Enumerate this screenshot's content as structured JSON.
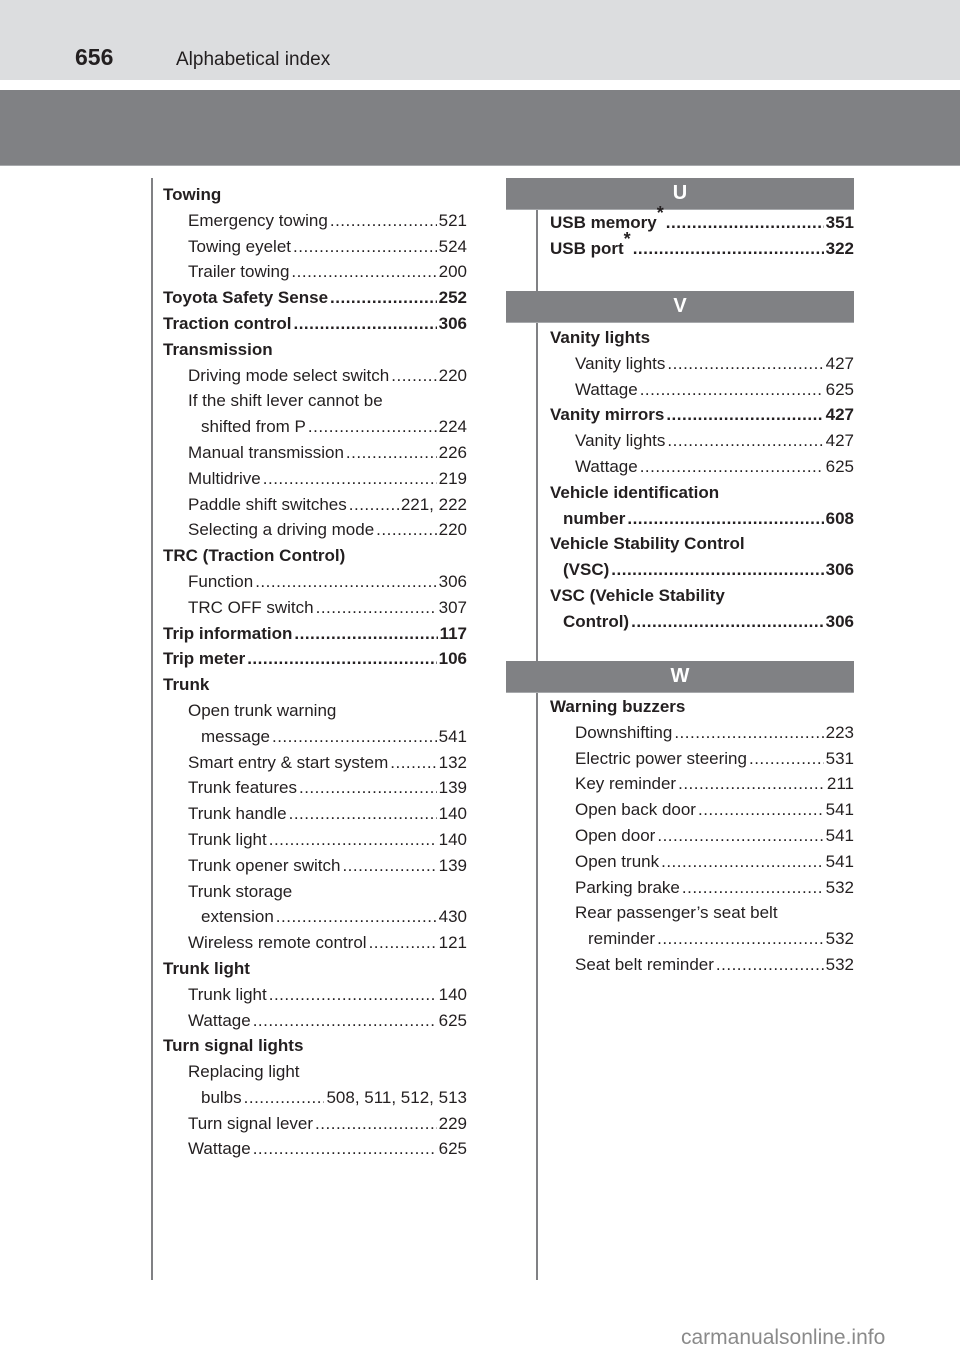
{
  "header": {
    "page_number": "656",
    "title": "Alphabetical index"
  },
  "left_column": [
    {
      "label": "Towing",
      "page": "",
      "level": 0,
      "bold": true
    },
    {
      "label": "Emergency towing",
      "page": "521",
      "level": 1,
      "bold": false
    },
    {
      "label": "Towing eyelet",
      "page": "524",
      "level": 1,
      "bold": false
    },
    {
      "label": "Trailer towing",
      "page": "200",
      "level": 1,
      "bold": false
    },
    {
      "label": "Toyota Safety Sense",
      "page": "252",
      "level": 0,
      "bold": true
    },
    {
      "label": "Traction control",
      "page": "306",
      "level": 0,
      "bold": true
    },
    {
      "label": "Transmission",
      "page": "",
      "level": 0,
      "bold": true
    },
    {
      "label": "Driving mode select switch",
      "page": "220",
      "level": 1,
      "bold": false
    },
    {
      "label": "If the shift lever cannot be",
      "page": "",
      "level": 1,
      "bold": false
    },
    {
      "label": "shifted from P",
      "page": "224",
      "level": 2,
      "bold": false
    },
    {
      "label": "Manual transmission",
      "page": "226",
      "level": 1,
      "bold": false
    },
    {
      "label": "Multidrive",
      "page": "219",
      "level": 1,
      "bold": false
    },
    {
      "label": "Paddle shift switches",
      "page": "221, 222",
      "level": 1,
      "bold": false
    },
    {
      "label": "Selecting a driving mode",
      "page": "220",
      "level": 1,
      "bold": false
    },
    {
      "label": "TRC (Traction Control)",
      "page": "",
      "level": 0,
      "bold": true
    },
    {
      "label": "Function",
      "page": "306",
      "level": 1,
      "bold": false
    },
    {
      "label": "TRC OFF switch",
      "page": "307",
      "level": 1,
      "bold": false
    },
    {
      "label": "Trip information",
      "page": "117",
      "level": 0,
      "bold": true
    },
    {
      "label": "Trip meter",
      "page": "106",
      "level": 0,
      "bold": true
    },
    {
      "label": "Trunk",
      "page": "",
      "level": 0,
      "bold": true
    },
    {
      "label": "Open trunk warning",
      "page": "",
      "level": 1,
      "bold": false
    },
    {
      "label": "message",
      "page": "541",
      "level": 2,
      "bold": false
    },
    {
      "label": "Smart entry & start system",
      "page": "132",
      "level": 1,
      "bold": false
    },
    {
      "label": "Trunk features",
      "page": "139",
      "level": 1,
      "bold": false
    },
    {
      "label": "Trunk handle",
      "page": "140",
      "level": 1,
      "bold": false
    },
    {
      "label": "Trunk light",
      "page": "140",
      "level": 1,
      "bold": false
    },
    {
      "label": "Trunk opener switch",
      "page": "139",
      "level": 1,
      "bold": false
    },
    {
      "label": "Trunk storage",
      "page": "",
      "level": 1,
      "bold": false
    },
    {
      "label": "extension",
      "page": "430",
      "level": 2,
      "bold": false
    },
    {
      "label": "Wireless remote control",
      "page": "121",
      "level": 1,
      "bold": false
    },
    {
      "label": "Trunk light",
      "page": "",
      "level": 0,
      "bold": true
    },
    {
      "label": "Trunk light",
      "page": "140",
      "level": 1,
      "bold": false
    },
    {
      "label": "Wattage",
      "page": "625",
      "level": 1,
      "bold": false
    },
    {
      "label": "Turn signal lights",
      "page": "",
      "level": 0,
      "bold": true
    },
    {
      "label": "Replacing light",
      "page": "",
      "level": 1,
      "bold": false
    },
    {
      "label": "bulbs",
      "page": "508, 511, 512, 513",
      "level": 2,
      "bold": false
    },
    {
      "label": "Turn signal lever",
      "page": "229",
      "level": 1,
      "bold": false
    },
    {
      "label": "Wattage",
      "page": "625",
      "level": 1,
      "bold": false
    }
  ],
  "right_sections": [
    {
      "letter": "U",
      "entries": [
        {
          "label": "USB memory",
          "asterisk": "*",
          "page": "351",
          "level": 0,
          "bold": true
        },
        {
          "label": "USB port",
          "asterisk": "*",
          "page": "322",
          "level": 0,
          "bold": true
        }
      ]
    },
    {
      "letter": "V",
      "entries": [
        {
          "label": "Vanity lights",
          "page": "",
          "level": 0,
          "bold": true
        },
        {
          "label": "Vanity lights",
          "page": "427",
          "level": 1,
          "bold": false
        },
        {
          "label": "Wattage",
          "page": "625",
          "level": 1,
          "bold": false
        },
        {
          "label": "Vanity mirrors",
          "page": "427",
          "level": 0,
          "bold": true
        },
        {
          "label": "Vanity lights",
          "page": "427",
          "level": 1,
          "bold": false
        },
        {
          "label": "Wattage",
          "page": "625",
          "level": 1,
          "bold": false
        },
        {
          "label": "Vehicle identification",
          "page": "",
          "level": 0,
          "bold": true
        },
        {
          "label": "number",
          "page": "608",
          "level": 2,
          "bold": true
        },
        {
          "label": "Vehicle Stability Control",
          "page": "",
          "level": 0,
          "bold": true
        },
        {
          "label": "(VSC)",
          "page": "306",
          "level": 2,
          "bold": true
        },
        {
          "label": "VSC (Vehicle Stability",
          "page": "",
          "level": 0,
          "bold": true
        },
        {
          "label": "Control)",
          "page": "306",
          "level": 2,
          "bold": true
        }
      ]
    },
    {
      "letter": "W",
      "entries": [
        {
          "label": "Warning buzzers",
          "page": "",
          "level": 0,
          "bold": true
        },
        {
          "label": "Downshifting",
          "page": "223",
          "level": 1,
          "bold": false
        },
        {
          "label": "Electric power steering",
          "page": "531",
          "level": 1,
          "bold": false
        },
        {
          "label": "Key reminder",
          "page": "211",
          "level": 1,
          "bold": false
        },
        {
          "label": "Open back door",
          "page": "541",
          "level": 1,
          "bold": false
        },
        {
          "label": "Open door",
          "page": "541",
          "level": 1,
          "bold": false
        },
        {
          "label": "Open trunk",
          "page": "541",
          "level": 1,
          "bold": false
        },
        {
          "label": "Parking brake",
          "page": "532",
          "level": 1,
          "bold": false
        },
        {
          "label": "Rear passenger’s seat belt",
          "page": "",
          "level": 1,
          "bold": false
        },
        {
          "label": "reminder",
          "page": "532",
          "level": 2,
          "bold": false
        },
        {
          "label": "Seat belt reminder",
          "page": "532",
          "level": 1,
          "bold": false
        }
      ]
    }
  ],
  "watermark": "carmanualsonline.info",
  "colors": {
    "header_band": "#dcdddf",
    "section_band": "#808184",
    "text": "#231f20",
    "letter_text": "#ffffff",
    "watermark": "#8a8a8a"
  }
}
